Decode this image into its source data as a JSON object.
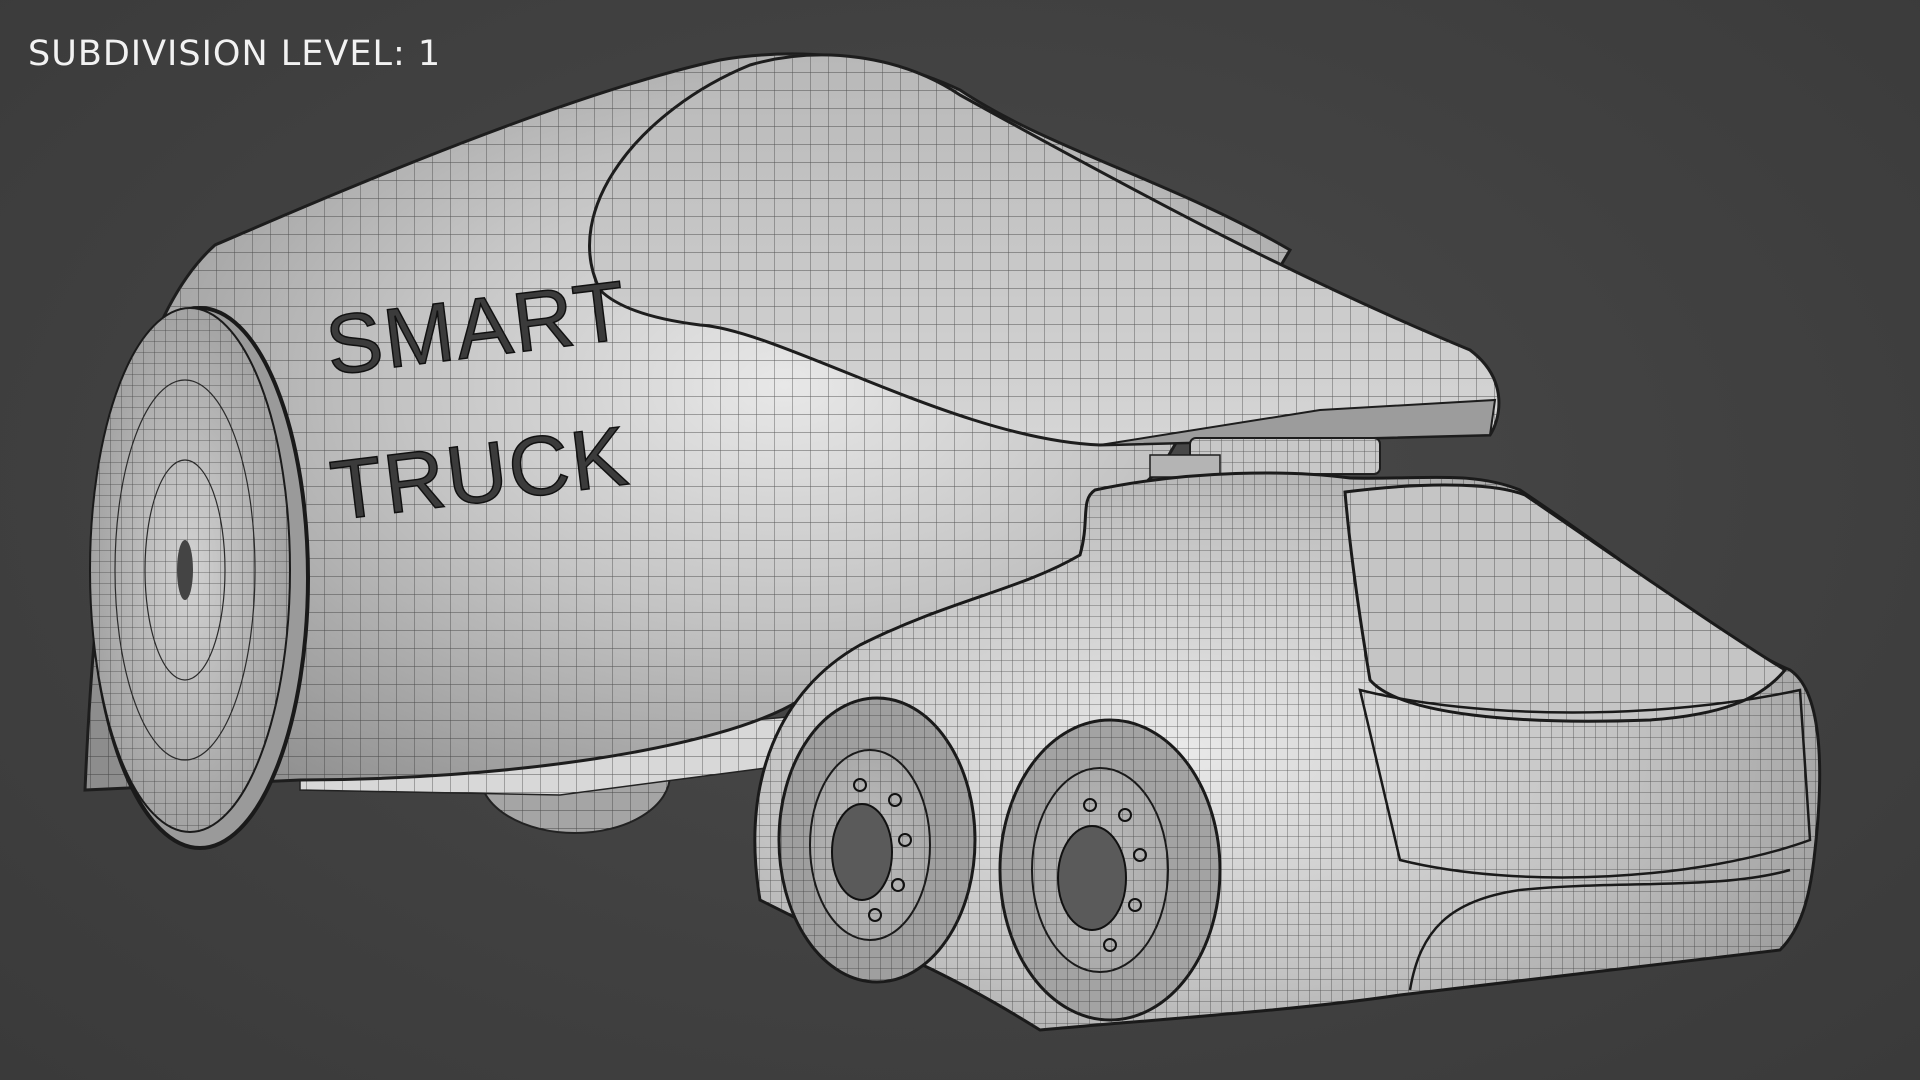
{
  "viewport": {
    "overlay_label": "SUBDIVISION LEVEL: 1",
    "background_color": "#414141"
  },
  "model": {
    "decal_line_1": "SMART",
    "decal_line_2": "TRUCK",
    "surface_color": "#c9c9c9",
    "wire_color": "#2a2a2a",
    "shading": "wireframe-on-shaded"
  }
}
